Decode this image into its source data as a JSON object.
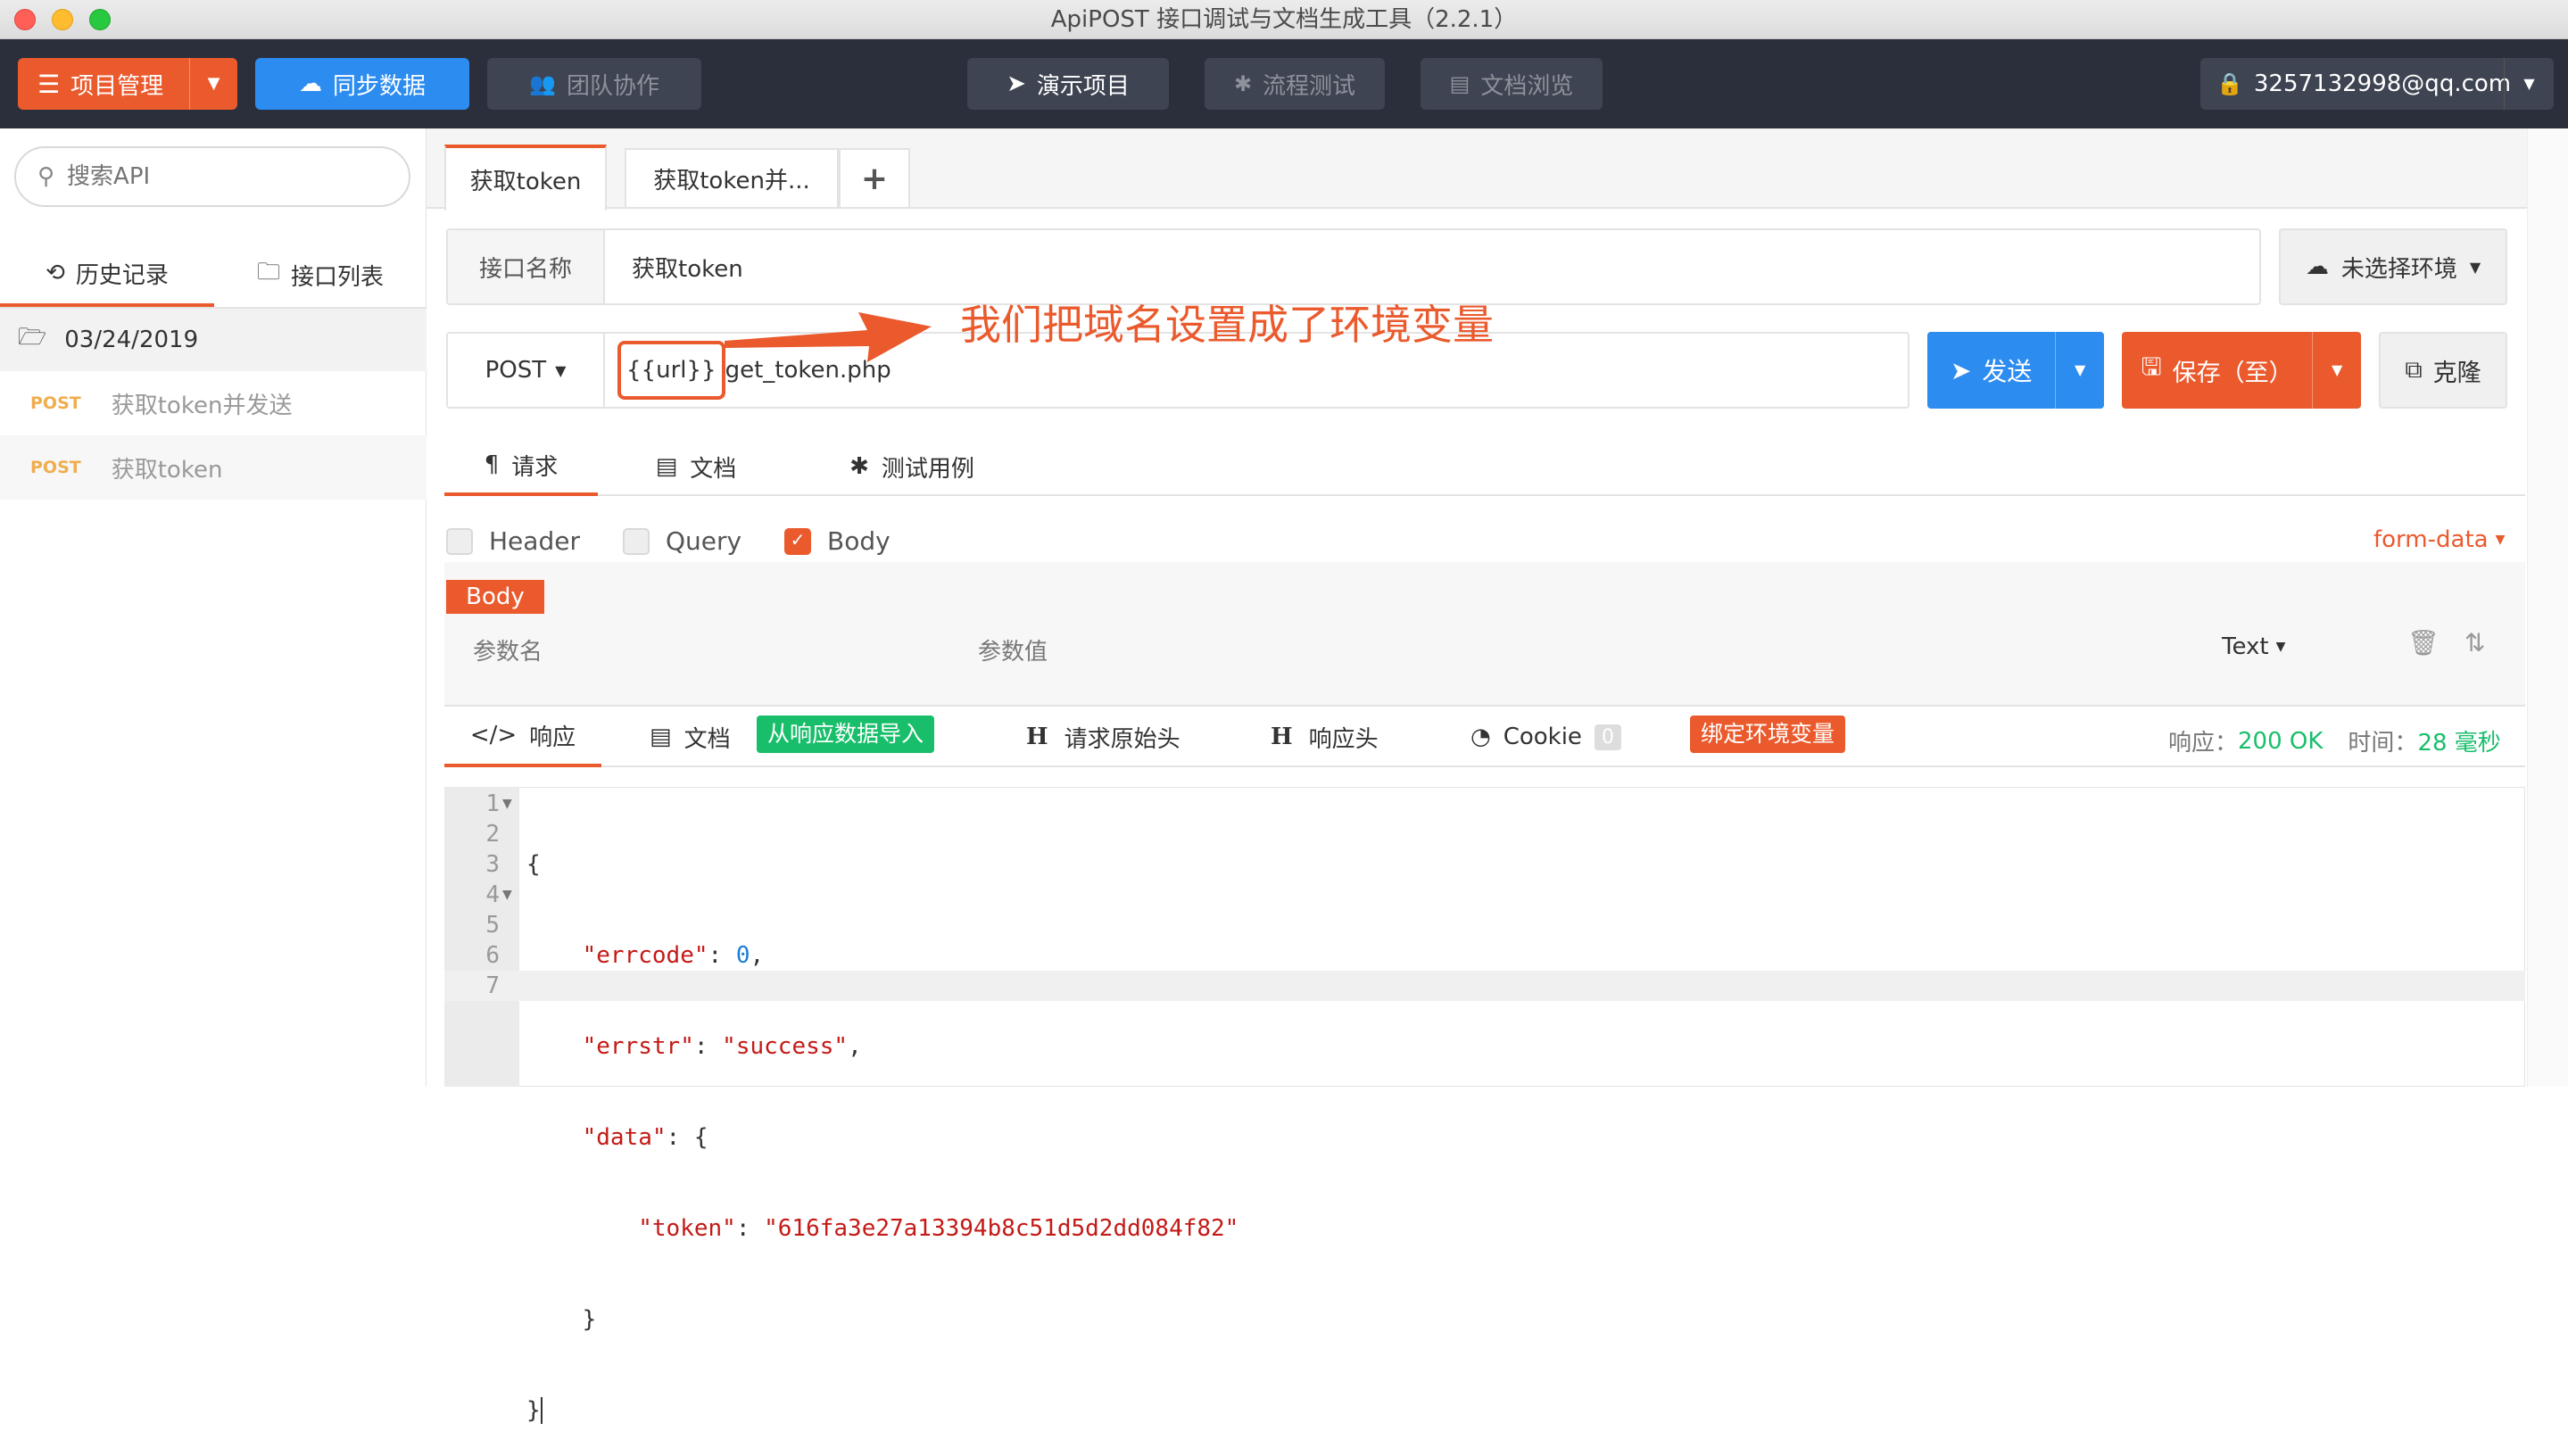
{
  "window": {
    "title": "ApiPOST 接口调试与文档生成工具（2.2.1）"
  },
  "topnav": {
    "project_mgmt": "项目管理",
    "sync": "同步数据",
    "team": "团队协作",
    "demo": "演示项目",
    "flow_test": "流程测试",
    "doc_browse": "文档浏览",
    "user": "3257132998@qq.com"
  },
  "sidebar": {
    "search_placeholder": "搜索API",
    "tab_history": "历史记录",
    "tab_list": "接口列表",
    "date": "03/24/2019",
    "items": [
      {
        "method": "POST",
        "name": "获取token并发送"
      },
      {
        "method": "POST",
        "name": "获取token"
      }
    ]
  },
  "tabs": {
    "active": "获取token",
    "second": "获取token并...",
    "add": "+"
  },
  "api": {
    "name_label": "接口名称",
    "name_value": "获取token",
    "env": "未选择环境",
    "method": "POST",
    "url_var": "{{url}}",
    "url_path": "get_token.php",
    "send": "发送",
    "save": "保存（至）",
    "clone": "克隆"
  },
  "annotation": "我们把域名设置成了环境变量",
  "req_tabs": {
    "request": "请求",
    "doc": "文档",
    "test": "测试用例"
  },
  "params": {
    "header": "Header",
    "query": "Query",
    "body": "Body",
    "body_checked": true,
    "form_type": "form-data",
    "body_tag": "Body",
    "col_name": "参数名",
    "col_value": "参数值",
    "value_type": "Text"
  },
  "resp_tabs": {
    "response": "响应",
    "doc": "文档",
    "import": "从响应数据导入",
    "raw_header": "请求原始头",
    "resp_header": "响应头",
    "cookie": "Cookie",
    "cookie_count": "0",
    "bind_env": "绑定环境变量",
    "status_label": "响应：",
    "status_value": "200 OK",
    "time_label": "时间：",
    "time_value": "28 毫秒"
  },
  "response_code": {
    "line_numbers": [
      "1",
      "2",
      "3",
      "4",
      "5",
      "6",
      "7"
    ],
    "open_brace": "{",
    "errcode_key": "\"errcode\"",
    "errcode_val": "0",
    "errstr_key": "\"errstr\"",
    "errstr_val": "\"success\"",
    "data_key": "\"data\"",
    "data_open": "{",
    "token_key": "\"token\"",
    "token_val": "\"616fa3e27a13394b8c51d5d2dd084f82\"",
    "data_close": "}",
    "close_brace": "}"
  },
  "colors": {
    "accent": "#ea5a2d",
    "blue": "#2d8cf0",
    "nav_bg": "#2a2f3b",
    "success": "#19be6b"
  }
}
